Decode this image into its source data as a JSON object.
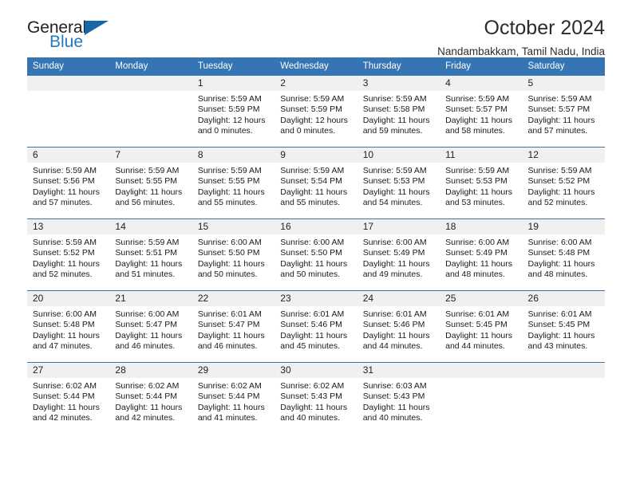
{
  "brand": {
    "name_part1": "General",
    "name_part2": "Blue",
    "triangle_icon": "triangle-icon",
    "accent_color": "#1e7bc4",
    "triangle_color": "#1666a8"
  },
  "header": {
    "title": "October 2024",
    "subtitle": "Nandambakkam, Tamil Nadu, India"
  },
  "theme": {
    "header_blue": "#3575b4",
    "daynum_band": "#f0f0f0",
    "text": "#1a1a1a"
  },
  "weekday_headers": [
    "Sunday",
    "Monday",
    "Tuesday",
    "Wednesday",
    "Thursday",
    "Friday",
    "Saturday"
  ],
  "weeks": [
    [
      {
        "day": "",
        "lines": []
      },
      {
        "day": "",
        "lines": []
      },
      {
        "day": "1",
        "lines": [
          "Sunrise: 5:59 AM",
          "Sunset: 5:59 PM",
          "Daylight: 12 hours",
          "and 0 minutes."
        ]
      },
      {
        "day": "2",
        "lines": [
          "Sunrise: 5:59 AM",
          "Sunset: 5:59 PM",
          "Daylight: 12 hours",
          "and 0 minutes."
        ]
      },
      {
        "day": "3",
        "lines": [
          "Sunrise: 5:59 AM",
          "Sunset: 5:58 PM",
          "Daylight: 11 hours",
          "and 59 minutes."
        ]
      },
      {
        "day": "4",
        "lines": [
          "Sunrise: 5:59 AM",
          "Sunset: 5:57 PM",
          "Daylight: 11 hours",
          "and 58 minutes."
        ]
      },
      {
        "day": "5",
        "lines": [
          "Sunrise: 5:59 AM",
          "Sunset: 5:57 PM",
          "Daylight: 11 hours",
          "and 57 minutes."
        ]
      }
    ],
    [
      {
        "day": "6",
        "lines": [
          "Sunrise: 5:59 AM",
          "Sunset: 5:56 PM",
          "Daylight: 11 hours",
          "and 57 minutes."
        ]
      },
      {
        "day": "7",
        "lines": [
          "Sunrise: 5:59 AM",
          "Sunset: 5:55 PM",
          "Daylight: 11 hours",
          "and 56 minutes."
        ]
      },
      {
        "day": "8",
        "lines": [
          "Sunrise: 5:59 AM",
          "Sunset: 5:55 PM",
          "Daylight: 11 hours",
          "and 55 minutes."
        ]
      },
      {
        "day": "9",
        "lines": [
          "Sunrise: 5:59 AM",
          "Sunset: 5:54 PM",
          "Daylight: 11 hours",
          "and 55 minutes."
        ]
      },
      {
        "day": "10",
        "lines": [
          "Sunrise: 5:59 AM",
          "Sunset: 5:53 PM",
          "Daylight: 11 hours",
          "and 54 minutes."
        ]
      },
      {
        "day": "11",
        "lines": [
          "Sunrise: 5:59 AM",
          "Sunset: 5:53 PM",
          "Daylight: 11 hours",
          "and 53 minutes."
        ]
      },
      {
        "day": "12",
        "lines": [
          "Sunrise: 5:59 AM",
          "Sunset: 5:52 PM",
          "Daylight: 11 hours",
          "and 52 minutes."
        ]
      }
    ],
    [
      {
        "day": "13",
        "lines": [
          "Sunrise: 5:59 AM",
          "Sunset: 5:52 PM",
          "Daylight: 11 hours",
          "and 52 minutes."
        ]
      },
      {
        "day": "14",
        "lines": [
          "Sunrise: 5:59 AM",
          "Sunset: 5:51 PM",
          "Daylight: 11 hours",
          "and 51 minutes."
        ]
      },
      {
        "day": "15",
        "lines": [
          "Sunrise: 6:00 AM",
          "Sunset: 5:50 PM",
          "Daylight: 11 hours",
          "and 50 minutes."
        ]
      },
      {
        "day": "16",
        "lines": [
          "Sunrise: 6:00 AM",
          "Sunset: 5:50 PM",
          "Daylight: 11 hours",
          "and 50 minutes."
        ]
      },
      {
        "day": "17",
        "lines": [
          "Sunrise: 6:00 AM",
          "Sunset: 5:49 PM",
          "Daylight: 11 hours",
          "and 49 minutes."
        ]
      },
      {
        "day": "18",
        "lines": [
          "Sunrise: 6:00 AM",
          "Sunset: 5:49 PM",
          "Daylight: 11 hours",
          "and 48 minutes."
        ]
      },
      {
        "day": "19",
        "lines": [
          "Sunrise: 6:00 AM",
          "Sunset: 5:48 PM",
          "Daylight: 11 hours",
          "and 48 minutes."
        ]
      }
    ],
    [
      {
        "day": "20",
        "lines": [
          "Sunrise: 6:00 AM",
          "Sunset: 5:48 PM",
          "Daylight: 11 hours",
          "and 47 minutes."
        ]
      },
      {
        "day": "21",
        "lines": [
          "Sunrise: 6:00 AM",
          "Sunset: 5:47 PM",
          "Daylight: 11 hours",
          "and 46 minutes."
        ]
      },
      {
        "day": "22",
        "lines": [
          "Sunrise: 6:01 AM",
          "Sunset: 5:47 PM",
          "Daylight: 11 hours",
          "and 46 minutes."
        ]
      },
      {
        "day": "23",
        "lines": [
          "Sunrise: 6:01 AM",
          "Sunset: 5:46 PM",
          "Daylight: 11 hours",
          "and 45 minutes."
        ]
      },
      {
        "day": "24",
        "lines": [
          "Sunrise: 6:01 AM",
          "Sunset: 5:46 PM",
          "Daylight: 11 hours",
          "and 44 minutes."
        ]
      },
      {
        "day": "25",
        "lines": [
          "Sunrise: 6:01 AM",
          "Sunset: 5:45 PM",
          "Daylight: 11 hours",
          "and 44 minutes."
        ]
      },
      {
        "day": "26",
        "lines": [
          "Sunrise: 6:01 AM",
          "Sunset: 5:45 PM",
          "Daylight: 11 hours",
          "and 43 minutes."
        ]
      }
    ],
    [
      {
        "day": "27",
        "lines": [
          "Sunrise: 6:02 AM",
          "Sunset: 5:44 PM",
          "Daylight: 11 hours",
          "and 42 minutes."
        ]
      },
      {
        "day": "28",
        "lines": [
          "Sunrise: 6:02 AM",
          "Sunset: 5:44 PM",
          "Daylight: 11 hours",
          "and 42 minutes."
        ]
      },
      {
        "day": "29",
        "lines": [
          "Sunrise: 6:02 AM",
          "Sunset: 5:44 PM",
          "Daylight: 11 hours",
          "and 41 minutes."
        ]
      },
      {
        "day": "30",
        "lines": [
          "Sunrise: 6:02 AM",
          "Sunset: 5:43 PM",
          "Daylight: 11 hours",
          "and 40 minutes."
        ]
      },
      {
        "day": "31",
        "lines": [
          "Sunrise: 6:03 AM",
          "Sunset: 5:43 PM",
          "Daylight: 11 hours",
          "and 40 minutes."
        ]
      },
      {
        "day": "",
        "lines": []
      },
      {
        "day": "",
        "lines": []
      }
    ]
  ]
}
